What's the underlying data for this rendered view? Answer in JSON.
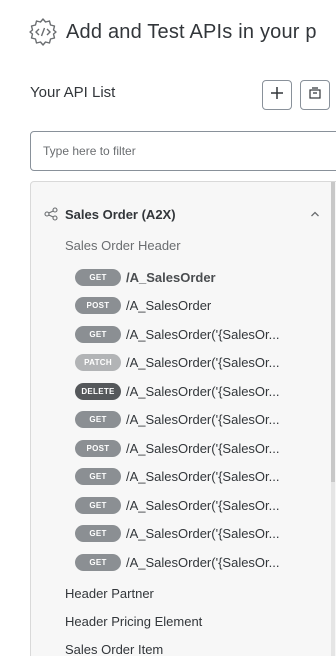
{
  "header": {
    "title": "Add and Test APIs in your p"
  },
  "list": {
    "title": "Your API List",
    "add_icon": "plus-icon",
    "import_icon": "import-icon"
  },
  "filter": {
    "placeholder": "Type here to filter",
    "value": ""
  },
  "group": {
    "icon": "share-network-icon",
    "label": "Sales Order (A2X)",
    "expanded": true,
    "section": "Sales Order Header",
    "endpoints": [
      {
        "method": "GET",
        "path": "/A_SalesOrder",
        "active": true
      },
      {
        "method": "POST",
        "path": "/A_SalesOrder",
        "active": false
      },
      {
        "method": "GET",
        "path": "/A_SalesOrder('{SalesOr...",
        "active": false
      },
      {
        "method": "PATCH",
        "path": "/A_SalesOrder('{SalesOr...",
        "active": false
      },
      {
        "method": "DELETE",
        "path": "/A_SalesOrder('{SalesOr...",
        "active": false
      },
      {
        "method": "GET",
        "path": "/A_SalesOrder('{SalesOr...",
        "active": false
      },
      {
        "method": "POST",
        "path": "/A_SalesOrder('{SalesOr...",
        "active": false
      },
      {
        "method": "GET",
        "path": "/A_SalesOrder('{SalesOr...",
        "active": false
      },
      {
        "method": "GET",
        "path": "/A_SalesOrder('{SalesOr...",
        "active": false
      },
      {
        "method": "GET",
        "path": "/A_SalesOrder('{SalesOr...",
        "active": false
      },
      {
        "method": "GET",
        "path": "/A_SalesOrder('{SalesOr...",
        "active": false
      }
    ],
    "subgroups": [
      "Header Partner",
      "Header Pricing Element",
      "Sales Order Item"
    ]
  },
  "colors": {
    "method_get": "#8b8f93",
    "method_patch": "#b2b4b6",
    "method_delete": "#55585b",
    "text": "#32363a",
    "muted": "#6a6d70",
    "border": "#89919a"
  }
}
